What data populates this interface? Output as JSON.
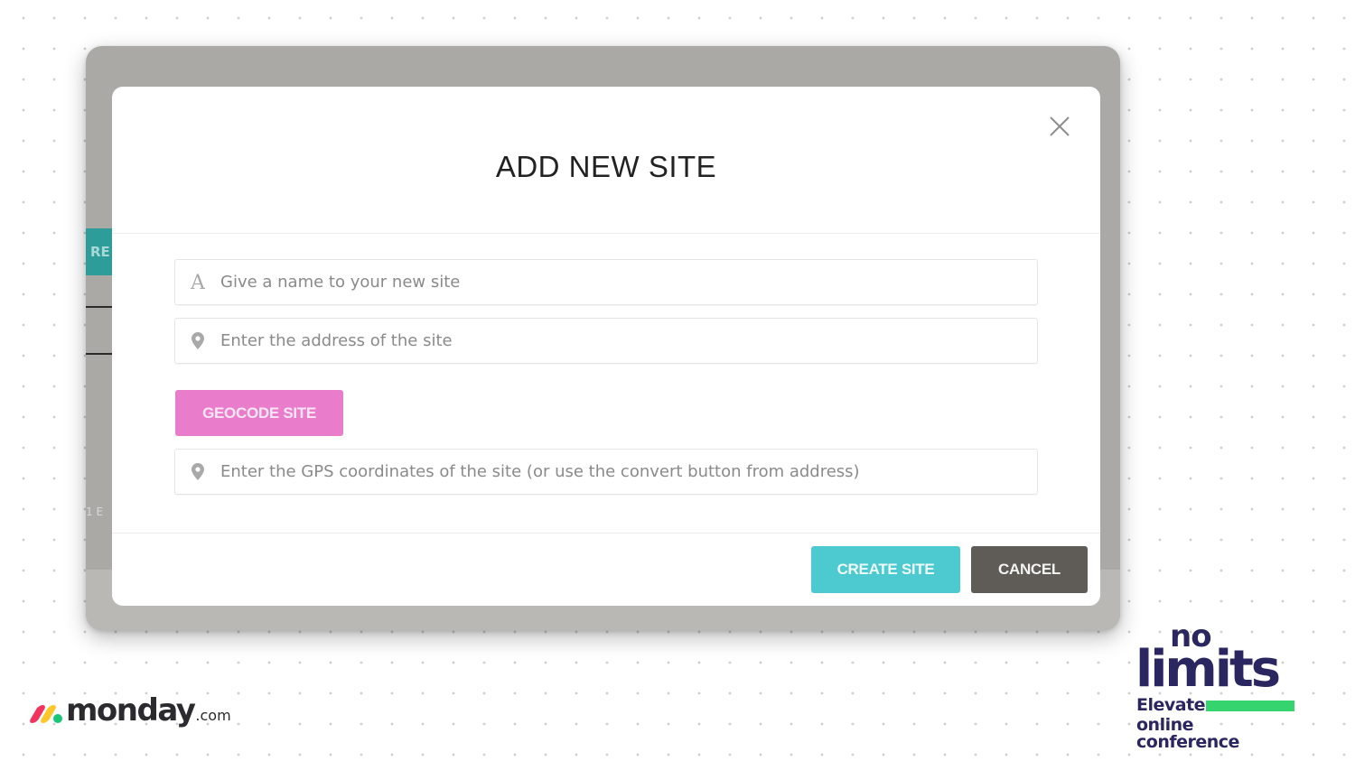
{
  "background_app": {
    "tab_partial_label": "RE",
    "partial_text": "1 E"
  },
  "modal": {
    "title": "ADD NEW SITE",
    "close_icon": "close-icon",
    "fields": {
      "name": {
        "value": "",
        "placeholder": "Give a name to your new site",
        "icon": "text-a-icon"
      },
      "address": {
        "value": "",
        "placeholder": "Enter the address of the site",
        "icon": "map-pin-icon"
      },
      "gps": {
        "value": "",
        "placeholder": "Enter the GPS coordinates of the site (or use the convert button from address)",
        "icon": "map-pin-icon"
      }
    },
    "geocode_label": "GEOCODE SITE",
    "create_label": "CREATE SITE",
    "cancel_label": "CANCEL"
  },
  "colors": {
    "geocode": "#ea7dcb",
    "create": "#4ccad0",
    "cancel": "#5f5b56",
    "brand_navy": "#2a2760",
    "brand_green": "#36d46e"
  },
  "branding": {
    "monday_word": "monday",
    "monday_domain": ".com",
    "nolimits_no": "no",
    "nolimits_limits": "limits",
    "nolimits_elevate": "Elevate",
    "nolimits_conference": "online conference"
  }
}
